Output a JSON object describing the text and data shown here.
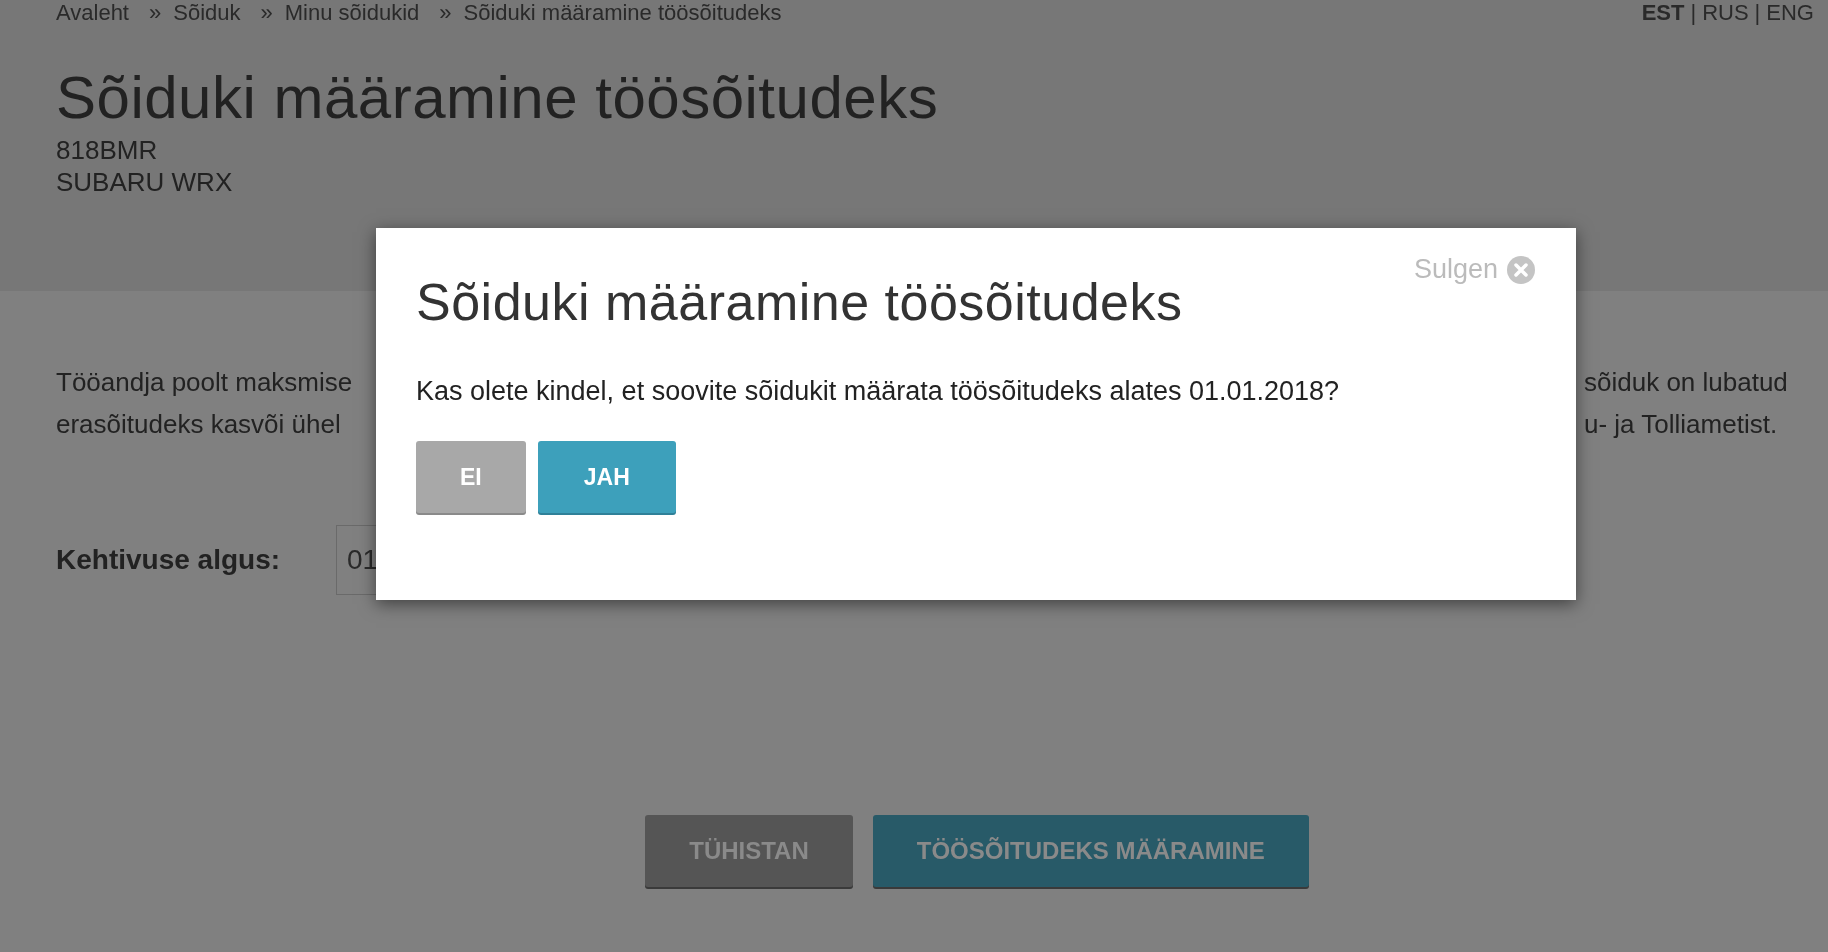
{
  "breadcrumb": [
    {
      "label": "Avaleht"
    },
    {
      "separator": "»",
      "label": "Sõiduk"
    },
    {
      "separator": "»",
      "label": "Minu sõidukid"
    },
    {
      "separator": "»",
      "label": "Sõiduki määramine töösõitudeks"
    }
  ],
  "languages": [
    {
      "label": "EST",
      "selected": true
    },
    {
      "divider": "|",
      "label": "RUS",
      "selected": false
    },
    {
      "divider": "|",
      "label": "ENG",
      "selected": false
    }
  ],
  "page_title": "Sõiduki määramine töösõitudeks",
  "vehicle": {
    "plate": "818BMR",
    "model": "SUBARU WRX"
  },
  "paragraph": {
    "left_lines": [
      "Tööandja poolt maksmise",
      "erasõitudeks kasvõi ühel"
    ],
    "right_lines": [
      "sõiduk on lubatud",
      "u- ja Tolliametist."
    ]
  },
  "valid_from": {
    "label": "Kehtivuse algus:",
    "value": "01"
  },
  "buttons": [
    {
      "label": "TÜHISTAN",
      "kind": "secondary"
    },
    {
      "label": "TÖÖSÕITUDEKS MÄÄRAMINE",
      "kind": "primary"
    }
  ],
  "dialog": {
    "title": "Sõiduki määramine töösõitudeks",
    "close_label": "Sulgen",
    "message": "Kas olete kindel, et soovite sõidukit määrata töösõitudeks alates 01.01.2018?",
    "buttons": [
      {
        "label": "EI",
        "kind": "secondary"
      },
      {
        "label": "JAH",
        "kind": "primary"
      }
    ]
  }
}
